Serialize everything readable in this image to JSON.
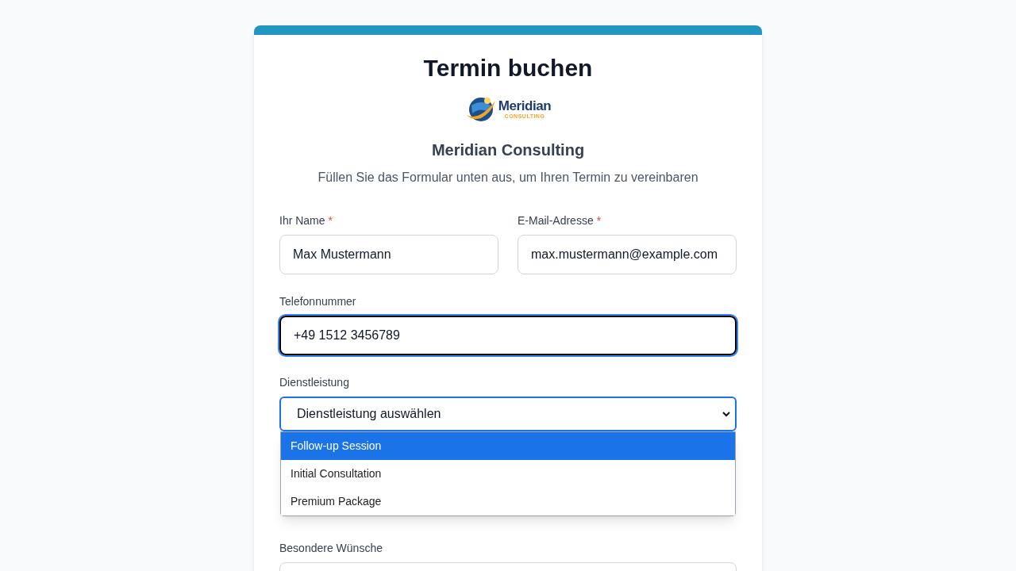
{
  "title": "Termin buchen",
  "logo": {
    "name": "Meridian",
    "tagline": "CONSULTING"
  },
  "company": "Meridian Consulting",
  "subtitle": "Füllen Sie das Formular unten aus, um Ihren Termin zu vereinbaren",
  "rows": [
    {
      "fields": [
        {
          "kind": "text",
          "label": "Ihr Name",
          "required_mark": "*",
          "value": "Max Mustermann",
          "focused": false
        },
        {
          "kind": "text",
          "label": "E-Mail-Adresse",
          "required_mark": "*",
          "value": "max.mustermann@example.com",
          "focused": false
        }
      ]
    },
    {
      "fields": [
        {
          "kind": "text",
          "label": "Telefonnummer",
          "value": "+49 1512 3456789",
          "focused": true
        }
      ]
    },
    {
      "fields": [
        {
          "kind": "select",
          "label": "Dienstleistung",
          "value": "Dienstleistung auswählen",
          "focused": true,
          "expanded": true,
          "options": [
            {
              "label": "Follow-up Session",
              "selected": true
            },
            {
              "label": "Initial Consultation",
              "selected": false
            },
            {
              "label": "Premium Package",
              "selected": false
            }
          ]
        }
      ]
    },
    {
      "fields": [
        {
          "kind": "textarea",
          "label": "Besondere Wünsche",
          "focused": false
        }
      ]
    }
  ]
}
